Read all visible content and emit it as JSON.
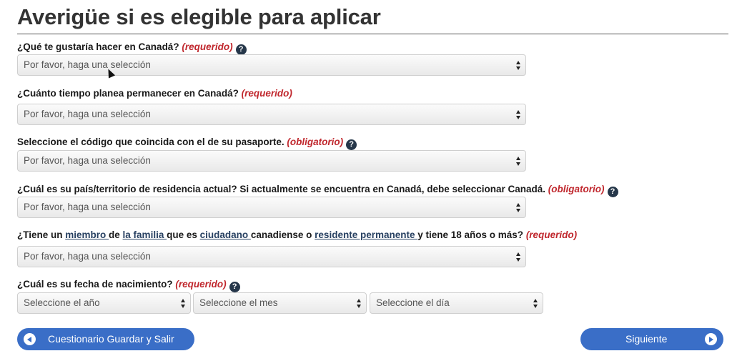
{
  "page_title": "Averigüe si es elegible para aplicar",
  "questions": [
    {
      "label": "¿Qué te gustaría hacer en Canadá?",
      "required_label": "(requerido)",
      "help_icon": "?",
      "select_placeholder": "Por favor, haga una selección"
    },
    {
      "label": "¿Cuánto tiempo planea permanecer en Canadá?",
      "required_label": "(requerido)",
      "select_placeholder": "Por favor, haga una selección"
    },
    {
      "label": "Seleccione el código que coincida con el de su pasaporte.",
      "required_label": "(obligatorio)",
      "help_icon": "?",
      "select_placeholder": "Por favor, haga una selección"
    },
    {
      "label": "¿Cuál es su país/territorio de residencia actual? Si actualmente se encuentra en Canadá, debe seleccionar Canadá.",
      "required_label": "(obligatorio)",
      "help_icon": "?",
      "select_placeholder": "Por favor, haga una selección"
    },
    {
      "label_parts": {
        "t1": "¿Tiene un ",
        "link1": "miembro ",
        "t2": "de ",
        "link2": "la familia ",
        "t3": "que es ",
        "link3": "ciudadano ",
        "t4": "canadiense o ",
        "link4": "residente permanente ",
        "t5": "y tiene 18 años o más?"
      },
      "required_label": "(requerido)",
      "select_placeholder": "Por favor, haga una selección"
    },
    {
      "label": "¿Cuál es su fecha de nacimiento?",
      "required_label": "(requerido)",
      "help_icon": "?",
      "year_placeholder": "Seleccione el año",
      "month_placeholder": "Seleccione el mes",
      "day_placeholder": "Seleccione el día"
    }
  ],
  "buttons": {
    "save_exit": "Cuestionario Guardar y Salir",
    "next": "Siguiente"
  },
  "colors": {
    "required": "#c0272d",
    "link": "#284162",
    "button": "#3a6ec7",
    "help_icon": "#26374a"
  }
}
